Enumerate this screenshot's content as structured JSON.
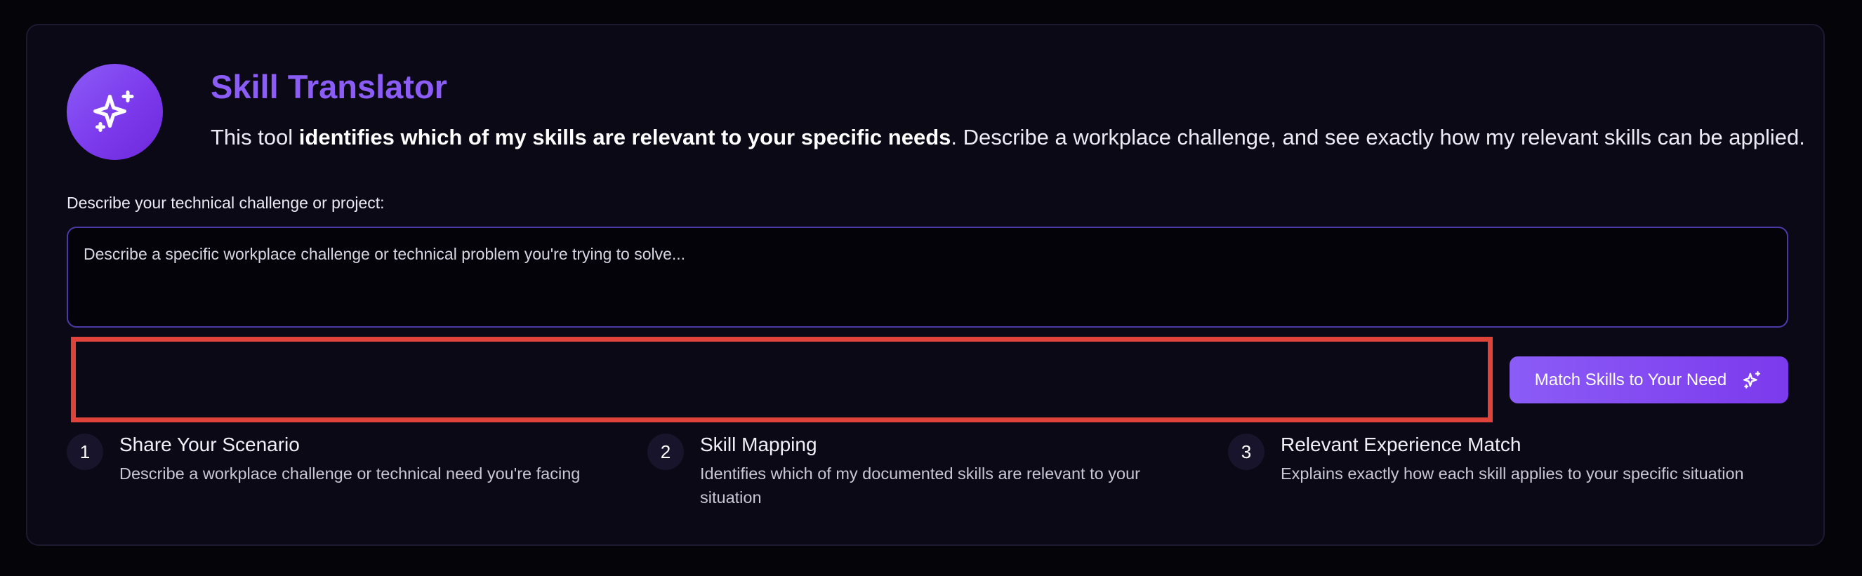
{
  "header": {
    "title": "Skill Translator",
    "desc_prefix": "This tool ",
    "desc_bold": "identifies which of my skills are relevant to your specific needs",
    "desc_suffix": ". Describe a workplace challenge, and see exactly how my relevant skills can be applied.",
    "logo_icon": "sparkles-icon"
  },
  "form": {
    "label": "Describe your technical challenge or project:",
    "placeholder": "Describe a specific workplace challenge or technical problem you're trying to solve...",
    "value": "",
    "submit_label": "Match Skills to Your Need",
    "submit_icon": "sparkles-icon"
  },
  "steps": [
    {
      "number": "1",
      "title": "Share Your Scenario",
      "description": "Describe a workplace challenge or technical need you're facing"
    },
    {
      "number": "2",
      "title": "Skill Mapping",
      "description": "Identifies which of my documented skills are relevant to your situation"
    },
    {
      "number": "3",
      "title": "Relevant Experience Match",
      "description": "Explains exactly how each skill applies to your specific situation"
    }
  ],
  "colors": {
    "accent": "#8b5cf6",
    "highlight": "#e0433a",
    "background": "#050409",
    "card": "#0b0916"
  }
}
